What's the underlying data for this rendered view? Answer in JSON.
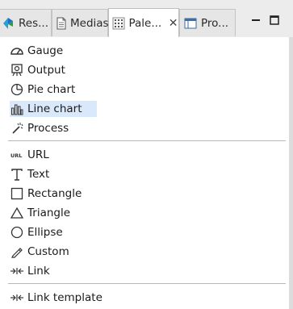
{
  "tabs": [
    {
      "label": "Res...",
      "icon": "resources-icon"
    },
    {
      "label": "Medias",
      "icon": "document-icon"
    },
    {
      "label": "Pale...",
      "icon": "palette-icon",
      "active": true
    },
    {
      "label": "Pro...",
      "icon": "properties-icon"
    }
  ],
  "tab_close_glyph": "✕",
  "palette": {
    "group1": [
      {
        "label": "Gauge",
        "icon": "gauge-icon"
      },
      {
        "label": "Output",
        "icon": "output-icon"
      },
      {
        "label": "Pie chart",
        "icon": "pie-chart-icon"
      },
      {
        "label": "Line chart",
        "icon": "line-chart-icon",
        "selected": true
      },
      {
        "label": "Process",
        "icon": "process-icon"
      }
    ],
    "group2": [
      {
        "label": "URL",
        "icon": "url-icon"
      },
      {
        "label": "Text",
        "icon": "text-icon"
      },
      {
        "label": "Rectangle",
        "icon": "rectangle-icon"
      },
      {
        "label": "Triangle",
        "icon": "triangle-icon"
      },
      {
        "label": "Ellipse",
        "icon": "ellipse-icon"
      },
      {
        "label": "Custom",
        "icon": "pencil-icon"
      },
      {
        "label": "Link",
        "icon": "link-icon"
      }
    ],
    "group3": [
      {
        "label": "Link template",
        "icon": "link-template-icon"
      }
    ]
  },
  "colors": {
    "selection": "#d9e8fb",
    "tabbar": "#ececec",
    "accent_green": "#2e9c46",
    "accent_blue": "#1f6fc4"
  }
}
